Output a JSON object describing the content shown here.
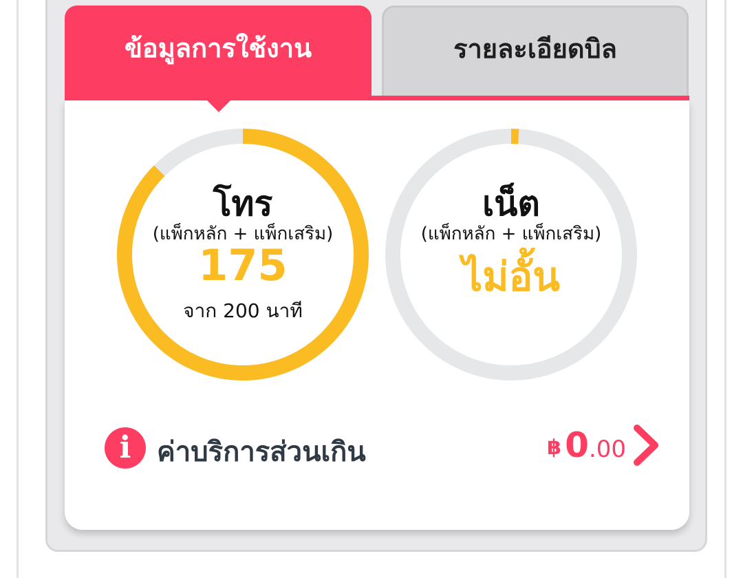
{
  "tabs": {
    "usage_label": "ข้อมูลการใช้งาน",
    "bill_label": "รายละเอียดบิล"
  },
  "voice": {
    "title": "โทร",
    "subtitle": "(แพ็กหลัก + แพ็กเสริม)",
    "value": "175",
    "of_text": "จาก 200 นาที",
    "used_fraction": 0.875
  },
  "data_usage": {
    "title": "เน็ต",
    "subtitle": "(แพ็กหลัก + แพ็กเสริม)",
    "value": "ไม่อั้น",
    "used_fraction": 0.01
  },
  "overage": {
    "label": "ค่าบริการส่วนเกิน",
    "currency": "฿",
    "amount_int": "0",
    "amount_dec": ".00"
  },
  "icons": {
    "info": "info-icon",
    "chevron": "chevron-right-icon"
  },
  "colors": {
    "accent": "#fe3d62",
    "gauge_fill": "#fbbc23",
    "gauge_track": "#e6e7e9",
    "inactive_tab": "#d5d5d8"
  }
}
